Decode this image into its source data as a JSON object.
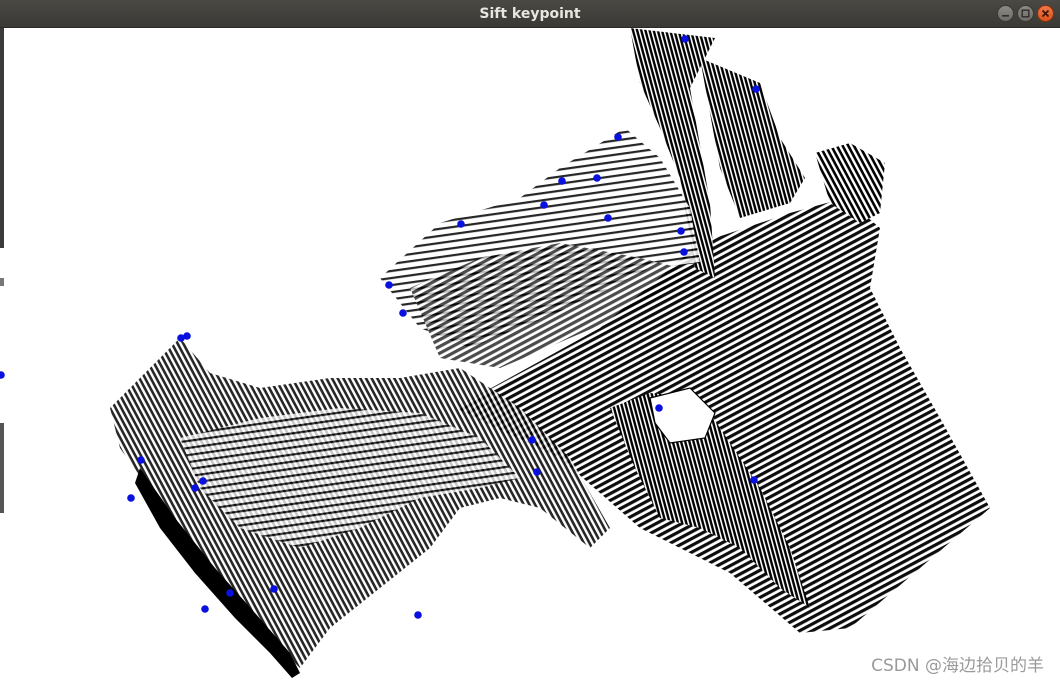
{
  "window": {
    "title": "Sift keypoint",
    "controls": {
      "minimize_icon": "minimize-icon",
      "maximize_icon": "maximize-icon",
      "close_icon": "close-icon"
    }
  },
  "viewer": {
    "background_color": "#ffffff",
    "point_color": "#000000",
    "keypoint_color": "#0a10e0"
  },
  "watermark": "CSDN @海边拾贝的羊"
}
